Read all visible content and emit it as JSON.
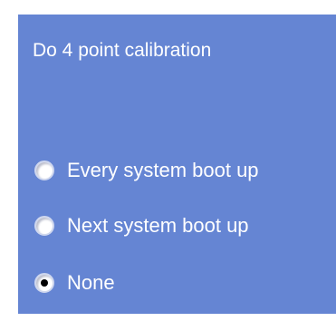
{
  "panel": {
    "background": "#6585d3",
    "heading": "Do 4 point calibration"
  },
  "options": [
    {
      "label": "Every system boot up",
      "selected": false
    },
    {
      "label": "Next system boot up",
      "selected": false
    },
    {
      "label": "None",
      "selected": true
    }
  ]
}
